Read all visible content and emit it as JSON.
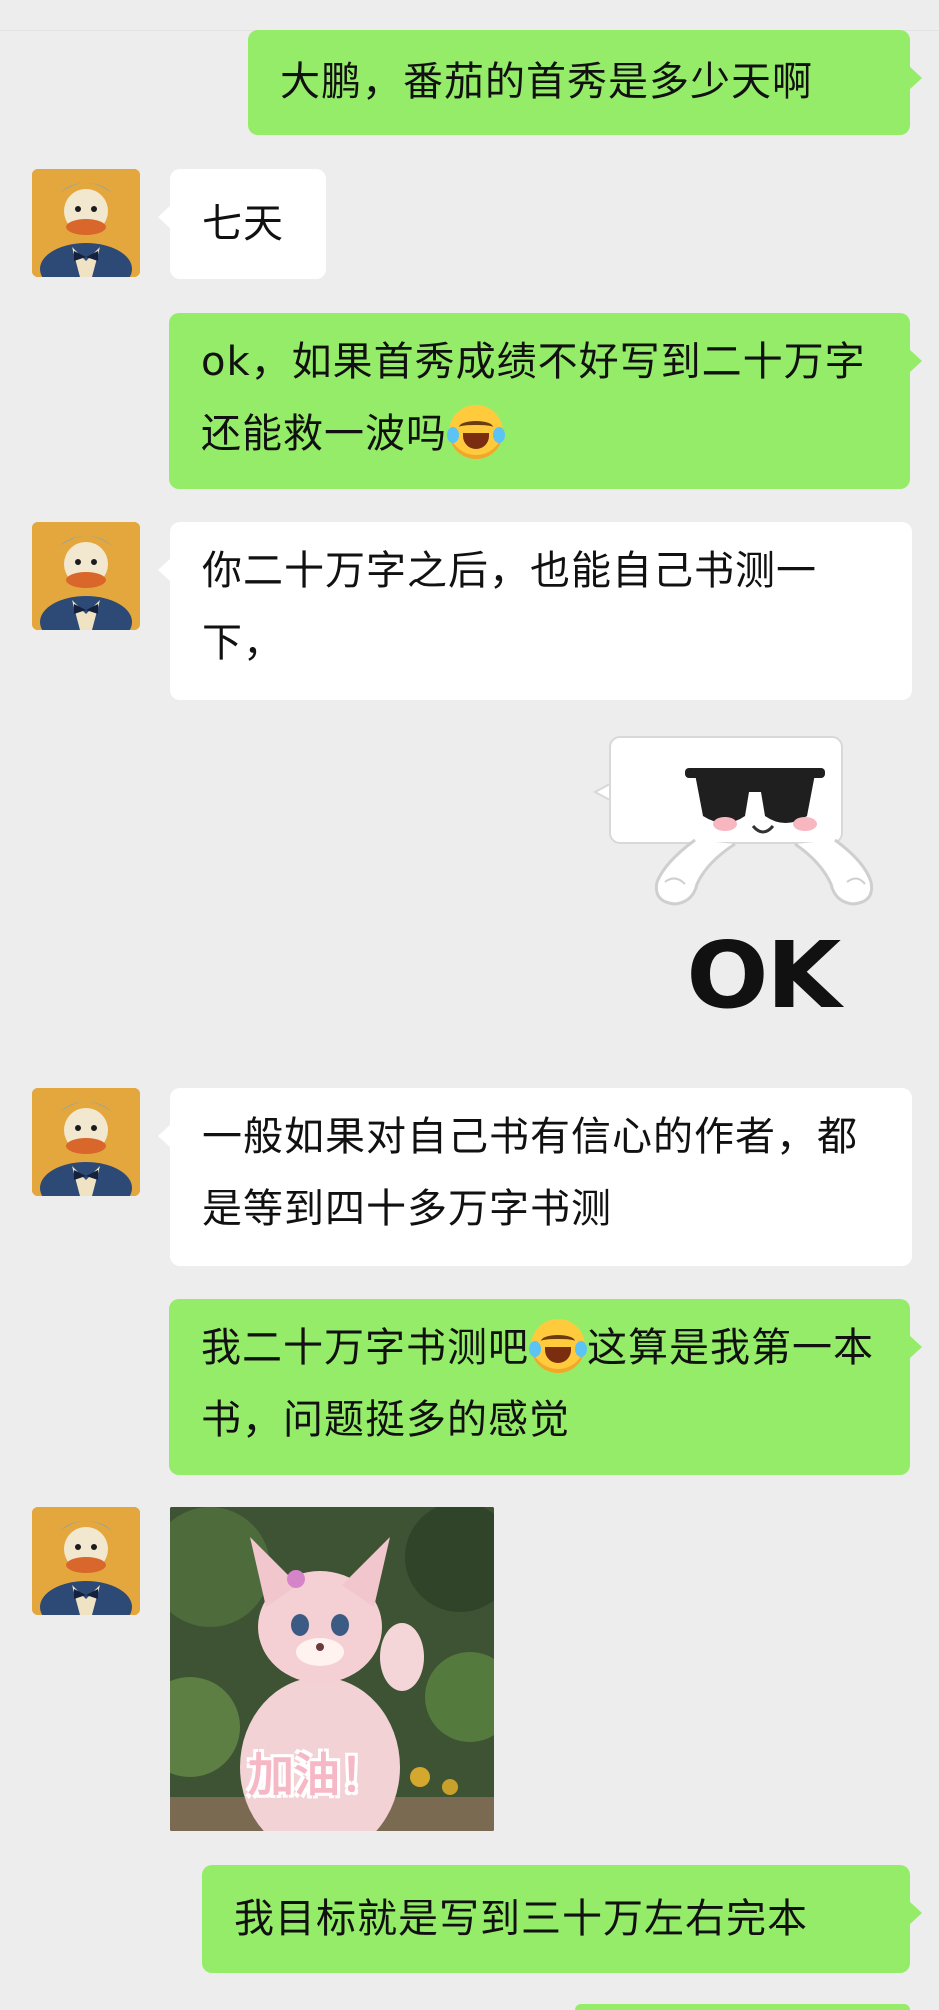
{
  "messages": [
    {
      "id": "m1",
      "sender": "me",
      "text": "大鹏，番茄的首秀是多少天啊"
    },
    {
      "id": "m2",
      "sender": "other",
      "text": "七天"
    },
    {
      "id": "m3",
      "sender": "me",
      "text_before": "ok，如果首秀成绩不好写到二十万字还能救一波吗",
      "emoji": "laugh-cry-emoji"
    },
    {
      "id": "m4",
      "sender": "other",
      "text": "你二十万字之后，也能自己书测一下，"
    },
    {
      "id": "m5",
      "sender": "me",
      "sticker": "sunglasses-ok-sticker",
      "sticker_text": "OK"
    },
    {
      "id": "m6",
      "sender": "other",
      "text": "一般如果对自己书有信心的作者，都是等到四十多万字书测"
    },
    {
      "id": "m7",
      "sender": "me",
      "text_before": "我二十万字书测吧",
      "emoji": "laugh-cry-emoji",
      "text_after": "这算是我第一本书，问题挺多的感觉"
    },
    {
      "id": "m8",
      "sender": "other",
      "image": "pink-mascot-gif",
      "image_text": "加油！"
    },
    {
      "id": "m9",
      "sender": "me",
      "text": "我目标就是写到三十万左右完本"
    }
  ],
  "colors": {
    "my_bubble": "#95ec69",
    "other_bubble": "#ffffff",
    "background": "#ededed"
  }
}
